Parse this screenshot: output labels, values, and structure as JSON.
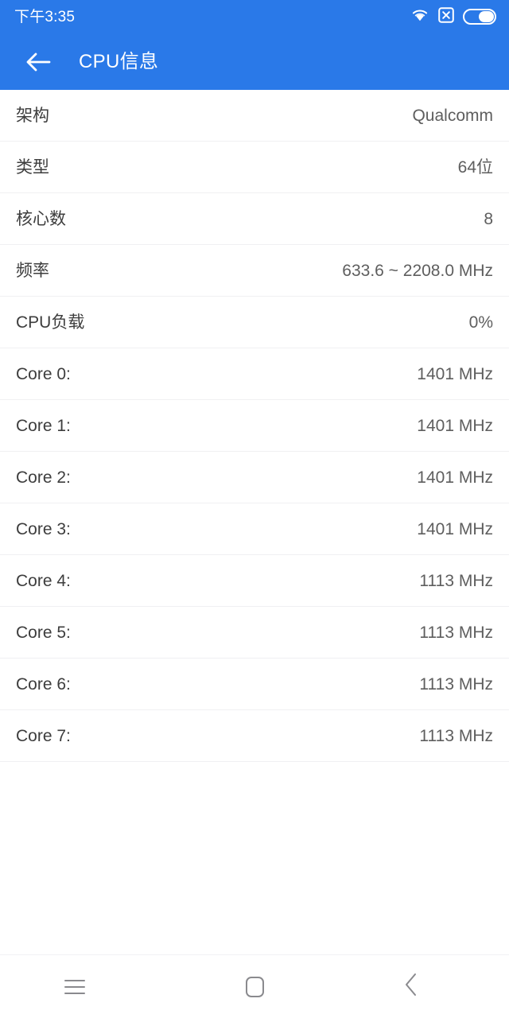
{
  "status_bar": {
    "time": "下午3:35",
    "icons": [
      {
        "name": "wifi-icon",
        "label": "WiFi"
      },
      {
        "name": "no-sim-icon",
        "label": "No SIM"
      },
      {
        "name": "battery-icon",
        "label": "Battery"
      }
    ]
  },
  "app_bar": {
    "back_label": "返回",
    "title": "CPU信息",
    "background_color": "#2a79e8",
    "text_color": "#ffffff"
  },
  "list": {
    "rows": [
      {
        "label": "架构",
        "value": "Qualcomm"
      },
      {
        "label": "类型",
        "value": "64位"
      },
      {
        "label": "核心数",
        "value": "8"
      },
      {
        "label": "频率",
        "value": "633.6 ~ 2208.0 MHz"
      },
      {
        "label": "CPU负载",
        "value": "0%"
      },
      {
        "label": "Core 0:",
        "value": "1401 MHz"
      },
      {
        "label": "Core 1:",
        "value": "1401 MHz"
      },
      {
        "label": "Core 2:",
        "value": "1401 MHz"
      },
      {
        "label": "Core 3:",
        "value": "1401 MHz"
      },
      {
        "label": "Core 4:",
        "value": "1113 MHz"
      },
      {
        "label": "Core 5:",
        "value": "1113 MHz"
      },
      {
        "label": "Core 6:",
        "value": "1113 MHz"
      },
      {
        "label": "Core 7:",
        "value": "1113 MHz"
      }
    ]
  },
  "nav_bar": {
    "buttons": [
      {
        "name": "menu-icon",
        "label": "菜单"
      },
      {
        "name": "home-icon",
        "label": "主页"
      },
      {
        "name": "back-icon",
        "label": "返回"
      }
    ]
  },
  "colors": {
    "accent": "#2a79e8",
    "label_text": "#3d3d3d",
    "value_text": "#5e5e5e",
    "divider": "#f0f0f2",
    "nav_icon": "#8a8a8e"
  }
}
